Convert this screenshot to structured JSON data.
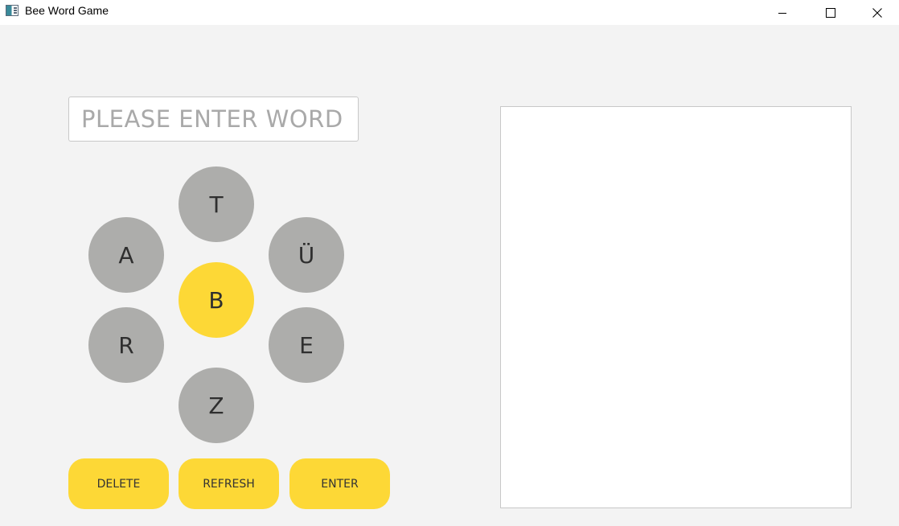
{
  "window": {
    "title": "Bee Word Game",
    "icon": "app-window-icon",
    "controls": [
      "minimize-icon",
      "maximize-icon",
      "close-icon"
    ]
  },
  "input": {
    "placeholder": "PLEASE ENTER WORD",
    "value": ""
  },
  "letters": {
    "center": "B",
    "top": "T",
    "upper_left": "A",
    "upper_right": "Ü",
    "lower_left": "R",
    "lower_right": "E",
    "bottom": "Z"
  },
  "buttons": {
    "delete": "DELETE",
    "refresh": "REFRESH",
    "enter": "ENTER"
  },
  "found_words": [],
  "colors": {
    "accent_yellow": "#fdd836",
    "tile_gray": "#adadab",
    "background": "#f3f3f3",
    "panel": "#ffffff"
  }
}
